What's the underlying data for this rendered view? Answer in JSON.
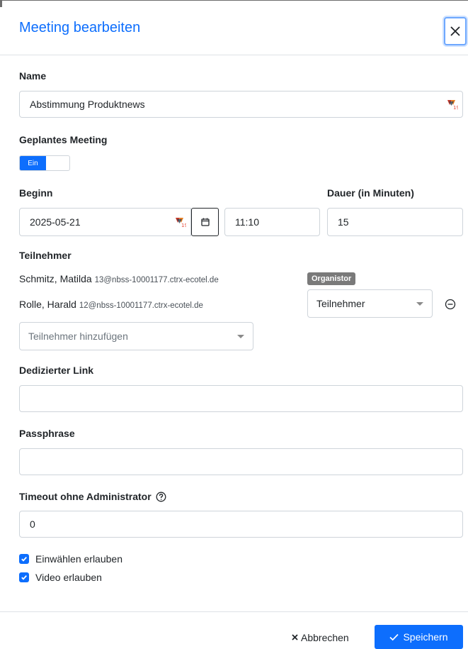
{
  "dialog": {
    "title": "Meeting bearbeiten"
  },
  "name": {
    "label": "Name",
    "value": "Abstimmung Produktnews"
  },
  "scheduled": {
    "label": "Geplantes Meeting",
    "toggle_label": "Ein",
    "toggle_state": "on"
  },
  "begin": {
    "label": "Beginn",
    "date": "2025-05-21",
    "time": "11:10"
  },
  "duration": {
    "label": "Dauer (in Minuten)",
    "value": "15"
  },
  "participants": {
    "label": "Teilnehmer",
    "list": [
      {
        "name": "Schmitz, Matilda",
        "email": "13@nbss-10001177.ctrx-ecotel.de",
        "role_badge": "Organistor"
      },
      {
        "name": "Rolle, Harald",
        "email": "12@nbss-10001177.ctrx-ecotel.de",
        "role_select": "Teilnehmer"
      }
    ],
    "add_placeholder": "Teilnehmer hinzufügen"
  },
  "dedicated_link": {
    "label": "Dedizierter Link",
    "value": ""
  },
  "passphrase": {
    "label": "Passphrase",
    "value": ""
  },
  "timeout": {
    "label": "Timeout ohne Administrator",
    "value": "0"
  },
  "options": {
    "dial_in": {
      "label": "Einwählen erlauben",
      "checked": true
    },
    "video": {
      "label": "Video erlauben",
      "checked": true
    }
  },
  "footer": {
    "cancel_label": "Abbrechen",
    "save_label": "Speichern"
  },
  "colors": {
    "accent": "#0d6efd",
    "badge": "#7a7a7a"
  },
  "icons": [
    "close-icon",
    "password-manager-icon",
    "calendar-icon",
    "remove-circle-icon",
    "help-circle-icon",
    "checkbox-check-icon",
    "x-icon",
    "checkmark-icon"
  ]
}
